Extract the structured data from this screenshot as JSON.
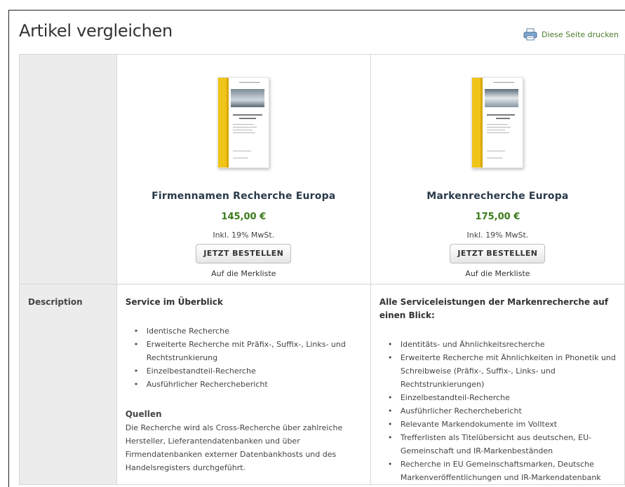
{
  "header": {
    "title": "Artikel vergleichen",
    "print_label": "Diese Seite drucken",
    "print_icon": "printer-icon"
  },
  "colors": {
    "accent_green": "#3a7a1a",
    "link_green": "#4a7d2a",
    "label_bg": "#ececec",
    "cover_yellow": "#f0c419"
  },
  "products": [
    {
      "name": "Firmennamen Recherche Europa",
      "price": "145,00 €",
      "vat": "Inkl. 19% MwSt.",
      "order_label": "JETZT BESTELLEN",
      "wishlist_label": "Auf die Merkliste"
    },
    {
      "name": "Markenrecherche Europa",
      "price": "175,00 €",
      "vat": "Inkl. 19% MwSt.",
      "order_label": "JETZT BESTELLEN",
      "wishlist_label": "Auf die Merkliste"
    }
  ],
  "description": {
    "label": "Description",
    "product1": {
      "heading": "Service im Überblick",
      "items": [
        "Identische Recherche",
        "Erweiterte Recherche mit Präfix-, Suffix-, Links- und Rechtstrunkierung",
        "Einzelbestandteil-Recherche",
        "Ausführlicher Recherchebericht"
      ],
      "sources_heading": "Quellen",
      "sources_text": "Die Recherche wird als Cross-Recherche über zahlreiche Hersteller, Lieferantendatenbanken und über Firmendatenbanken externer Datenbankhosts und des Handelsregisters durchgeführt."
    },
    "product2": {
      "heading": "Alle Serviceleistungen der Markenrecherche auf einen Blick:",
      "items": [
        "Identitäts- und Ähnlichkeitsrecherche",
        "Erweiterte Recherche mit Ähnlichkeiten in Phonetik und Schreibweise (Präfix-, Suffix-, Links- und Rechtstrunkierungen)",
        "Einzelbestandteil-Recherche",
        "Ausführlicher Recherchebericht",
        "Relevante Markendokumente im Volltext",
        "Trefferlisten als Titelübersicht aus deutschen, EU-Gemeinschaft und IR-Markenbeständen",
        "Recherche in EU Gemeinschaftsmarken, Deutsche Markenveröffentlichungen und IR-Markendatenbank"
      ]
    }
  }
}
